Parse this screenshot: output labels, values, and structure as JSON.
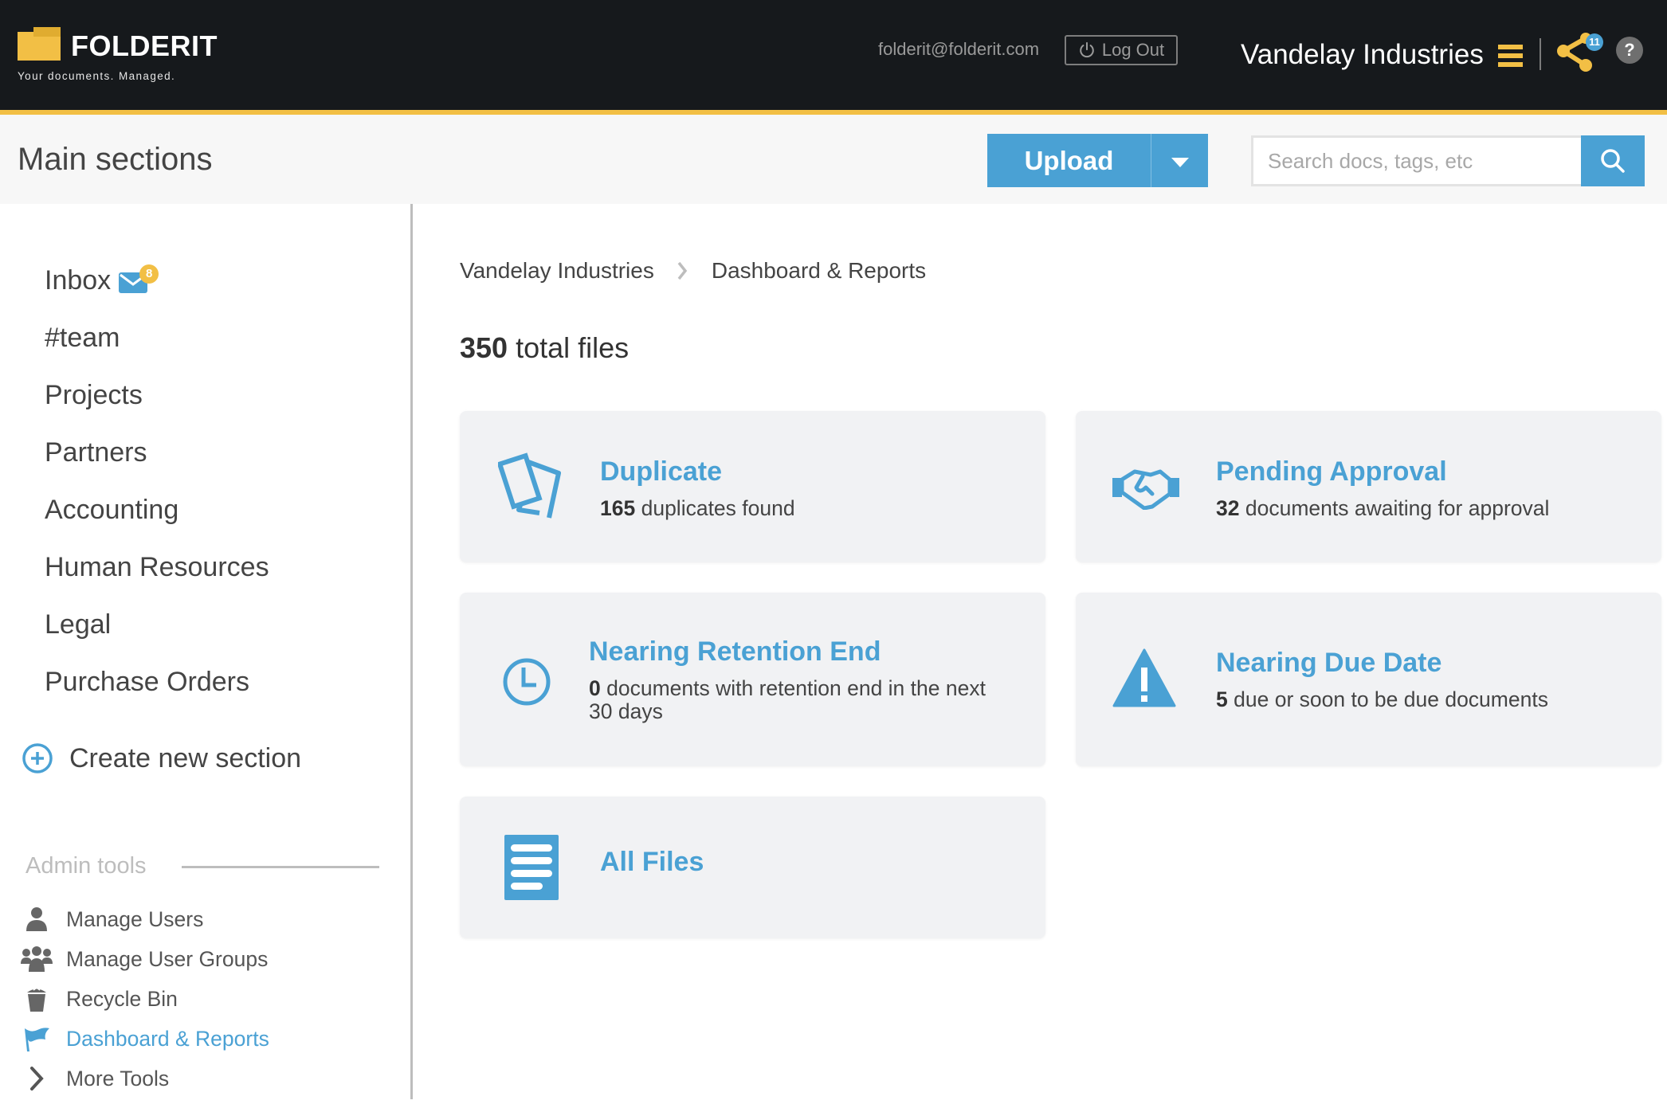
{
  "header": {
    "brand": "FOLDERIT",
    "tagline": "Your documents. Managed.",
    "user_email": "folderit@folderit.com",
    "logout_label": "Log Out",
    "organization": "Vandelay Industries",
    "share_count": "11",
    "help_label": "?"
  },
  "subheader": {
    "title": "Main sections",
    "upload_label": "Upload",
    "search_placeholder": "Search docs, tags, etc",
    "search_value": ""
  },
  "sidebar": {
    "sections": [
      {
        "label": "Inbox",
        "badge": "8",
        "icon": "envelope-icon"
      },
      {
        "label": "#team"
      },
      {
        "label": "Projects"
      },
      {
        "label": "Partners"
      },
      {
        "label": "Accounting"
      },
      {
        "label": "Human Resources"
      },
      {
        "label": "Legal"
      },
      {
        "label": "Purchase Orders"
      }
    ],
    "create_label": "Create new section",
    "admin_title": "Admin tools",
    "admin_items": [
      {
        "label": "Manage Users",
        "icon": "user-icon"
      },
      {
        "label": "Manage User Groups",
        "icon": "users-group-icon"
      },
      {
        "label": "Recycle Bin",
        "icon": "trash-icon"
      },
      {
        "label": "Dashboard & Reports",
        "icon": "flag-icon",
        "active": true
      },
      {
        "label": "More Tools",
        "icon": "chevron-right-icon"
      }
    ]
  },
  "main": {
    "breadcrumb": [
      "Vandelay Industries",
      "Dashboard & Reports"
    ],
    "total_files_count": "350",
    "total_files_label": "total files",
    "cards": [
      {
        "title": "Duplicate",
        "count": "165",
        "text": "duplicates found",
        "icon": "duplicate-icon"
      },
      {
        "title": "Pending Approval",
        "count": "32",
        "text": "documents awaiting for approval",
        "icon": "handshake-icon"
      },
      {
        "title": "Nearing Retention End",
        "count": "0",
        "text": "documents with retention end in the next 30 days",
        "icon": "clock-icon"
      },
      {
        "title": "Nearing Due Date",
        "count": "5",
        "text": "due or soon to be due documents",
        "icon": "warning-icon"
      },
      {
        "title": "All Files",
        "icon": "document-list-icon"
      }
    ]
  },
  "colors": {
    "topbar": "#16191c",
    "accent_yellow": "#f2bf45",
    "accent_blue": "#4aa1d4",
    "card_bg": "#f1f2f4"
  }
}
